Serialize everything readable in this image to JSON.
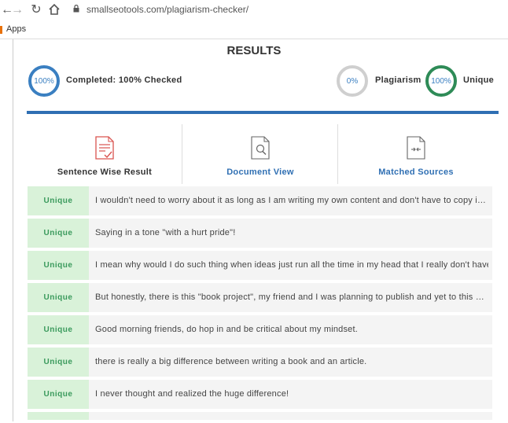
{
  "browser": {
    "url": "smallseotools.com/plagiarism-checker/",
    "bookmarks_label": "Apps"
  },
  "results": {
    "title": "RESULTS",
    "completed_percent": "100%",
    "completed_label": "Completed: 100% Checked",
    "plagiarism_percent": "0%",
    "plagiarism_label": "Plagiarism",
    "unique_percent": "100%",
    "unique_label": "Unique",
    "progress": 1.0
  },
  "tabs": [
    {
      "label": "Sentence Wise Result",
      "icon": "report-icon"
    },
    {
      "label": "Document View",
      "icon": "document-search-icon"
    },
    {
      "label": "Matched Sources",
      "icon": "document-compare-icon"
    }
  ],
  "rows": [
    {
      "status": "Unique",
      "text": "I wouldn't need to worry about it as long as I am writing my own content and don't have to copy ideas..."
    },
    {
      "status": "Unique",
      "text": "Saying in a tone \"with a hurt pride\"!"
    },
    {
      "status": "Unique",
      "text": "I mean why would I do such thing when ideas just run all the time in my head that I really don't have t"
    },
    {
      "status": "Unique",
      "text": "But honestly, there is this \"book project\", my friend and I was planning to publish and yet to this point ..."
    },
    {
      "status": "Unique",
      "text": "Good morning friends, do hop in and be critical about my mindset."
    },
    {
      "status": "Unique",
      "text": "there is really a big difference between writing a book and an article."
    },
    {
      "status": "Unique",
      "text": "I never thought and realized the huge difference!"
    }
  ],
  "colors": {
    "accent_blue": "#2f6fb3",
    "unique_green": "#2e8b57",
    "badge_bg": "#d9f2d9",
    "report_red": "#d9534f"
  }
}
